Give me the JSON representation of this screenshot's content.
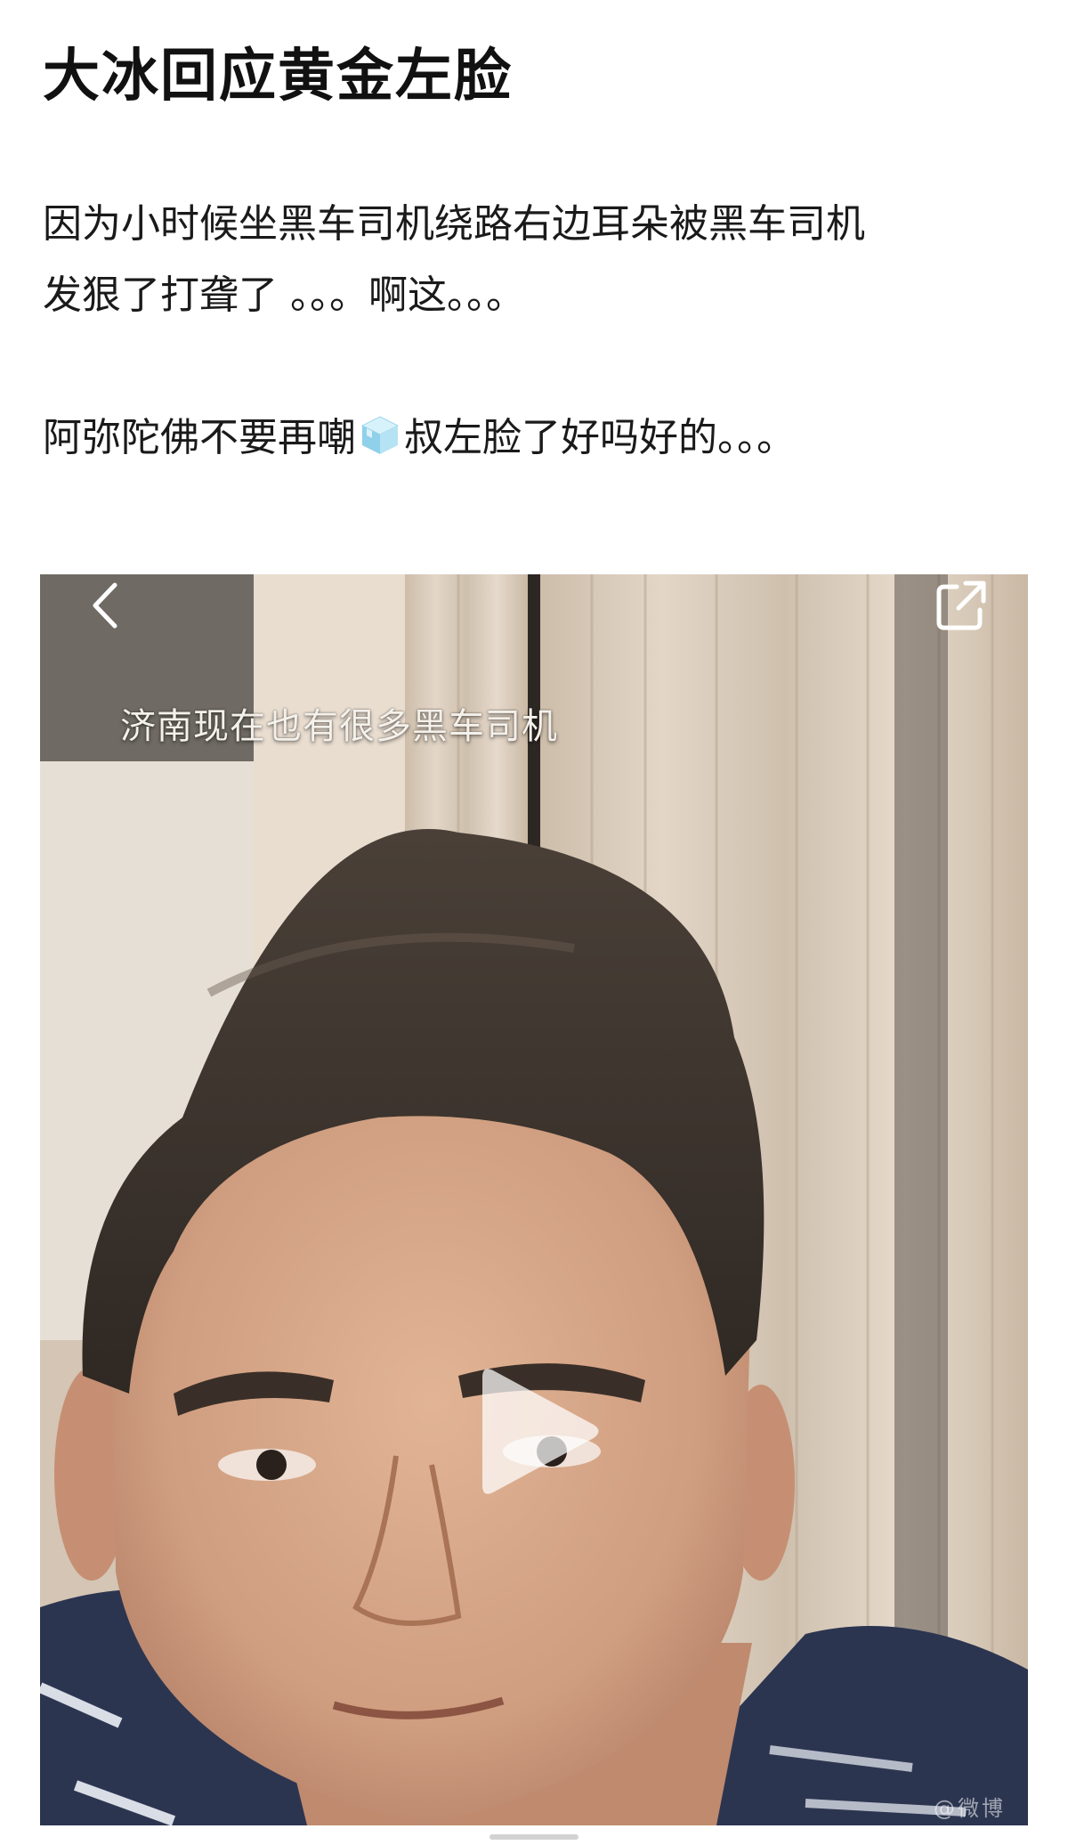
{
  "post": {
    "title": "大冰回应黄金左脸",
    "line_1": "因为小时候坐黑车司机绕路右边耳朵被黑车司机",
    "line_2": "发狠了打聋了 。。。啊这。。。",
    "line_3_before_emoji": "阿弥陀佛不要再嘲",
    "emoji": "ice-cube-emoji",
    "line_3_after_emoji": "叔左脸了好吗好的。。。"
  },
  "video": {
    "subtitle": "济南现在也有很多黑车司机",
    "watermark": "@微博",
    "icons": {
      "back": "chevron-left-icon",
      "share": "share-icon",
      "play": "play-icon"
    }
  },
  "colors": {
    "background": "#ffffff",
    "text": "#111111",
    "curtain": "#d8cabb",
    "hair": "#3a322c",
    "skin": "#d9a98a",
    "shirt": "#2c3550"
  }
}
